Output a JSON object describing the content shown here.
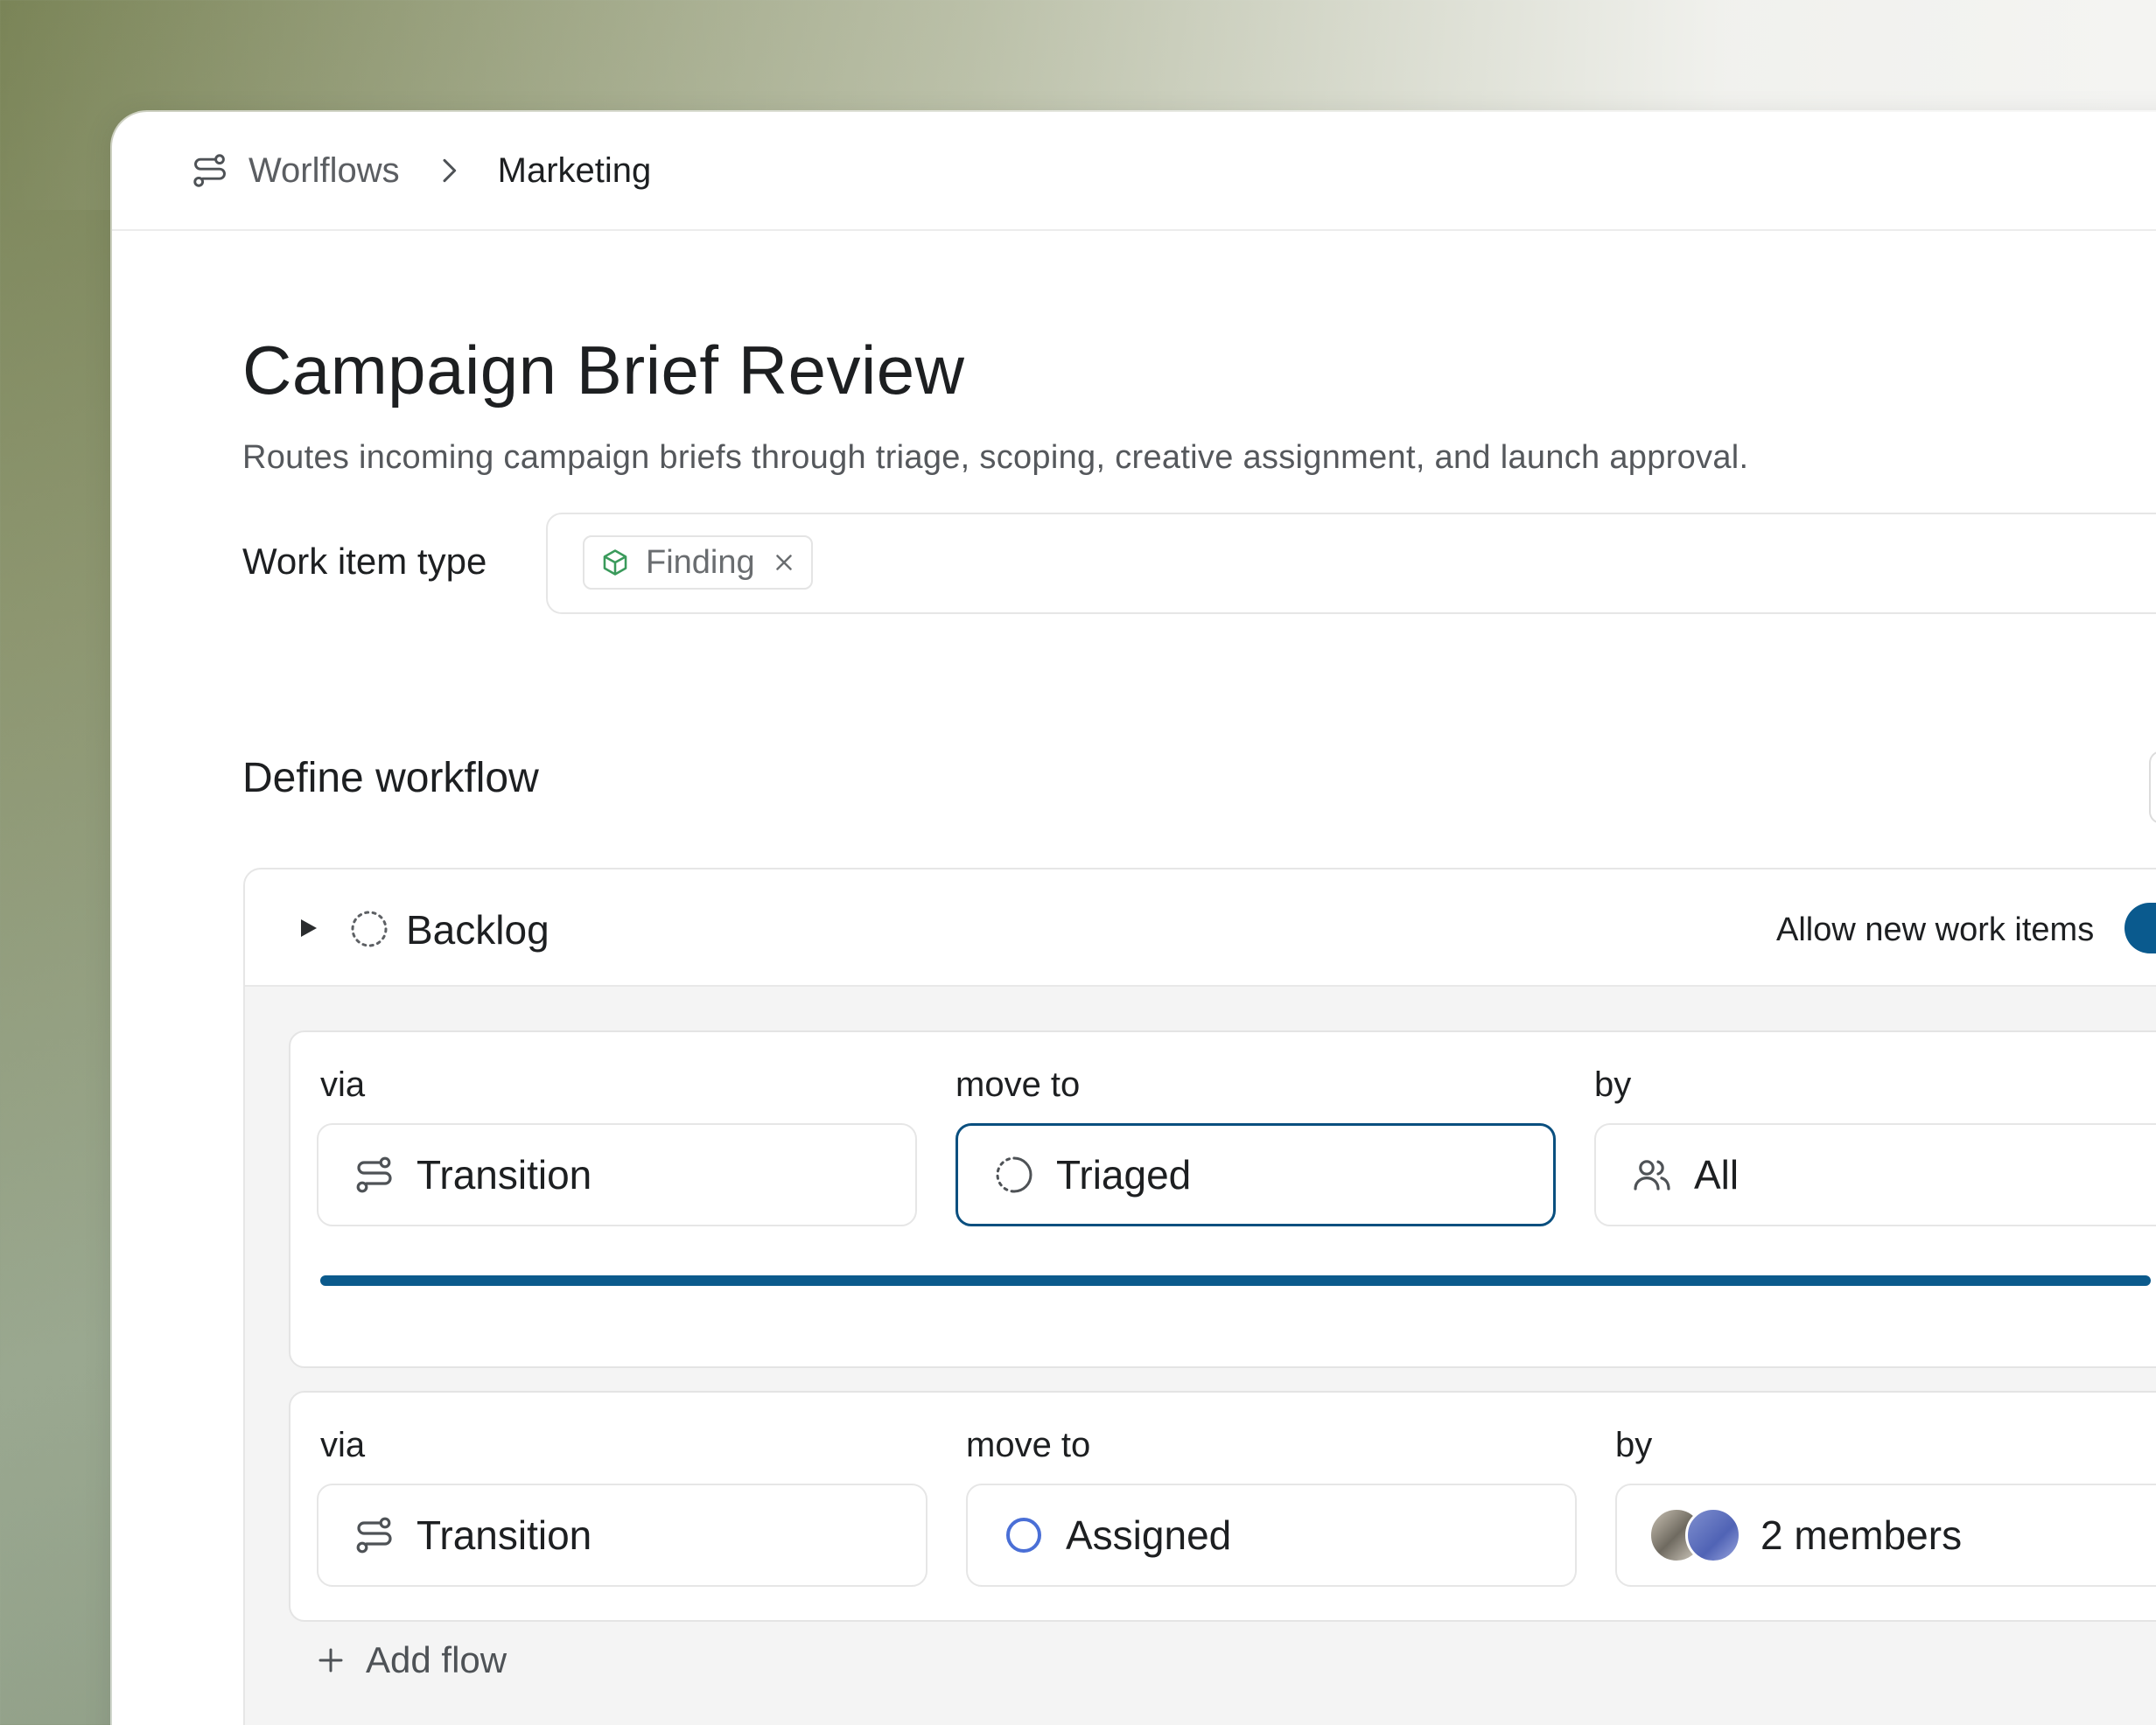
{
  "breadcrumb": {
    "root": "Worlflows",
    "current": "Marketing"
  },
  "page": {
    "title": "Campaign Brief Review",
    "description": "Routes incoming campaign briefs through triage, scoping, creative assignment, and launch approval."
  },
  "work_item_type": {
    "label": "Work item type",
    "chip": "Finding"
  },
  "workflow": {
    "section_title": "Define workflow",
    "state": {
      "name": "Backlog",
      "allow_label": "Allow new work items",
      "allow_enabled": true
    },
    "flows": [
      {
        "via_label": "via",
        "via_value": "Transition",
        "move_label": "move to",
        "move_value": "Triaged",
        "by_label": "by",
        "by_value": "All"
      },
      {
        "via_label": "via",
        "via_value": "Transition",
        "move_label": "move to",
        "move_value": "Assigned",
        "by_label": "by",
        "by_value": "2 members"
      }
    ],
    "add_flow": "Add flow"
  },
  "colors": {
    "accent": "#0a5a8e",
    "chip_icon": "#3a9a5b",
    "assigned_ring": "#4a6fd6"
  },
  "icons": {
    "workflow": "workflow-icon",
    "chevron": "chevron-right-icon",
    "cube": "cube-icon",
    "close": "close-icon",
    "caret": "caret-right-icon",
    "backlog": "dotted-circle-icon",
    "triaged": "half-dotted-circle-icon",
    "assigned": "circle-icon",
    "users": "users-icon",
    "plus": "plus-icon"
  }
}
